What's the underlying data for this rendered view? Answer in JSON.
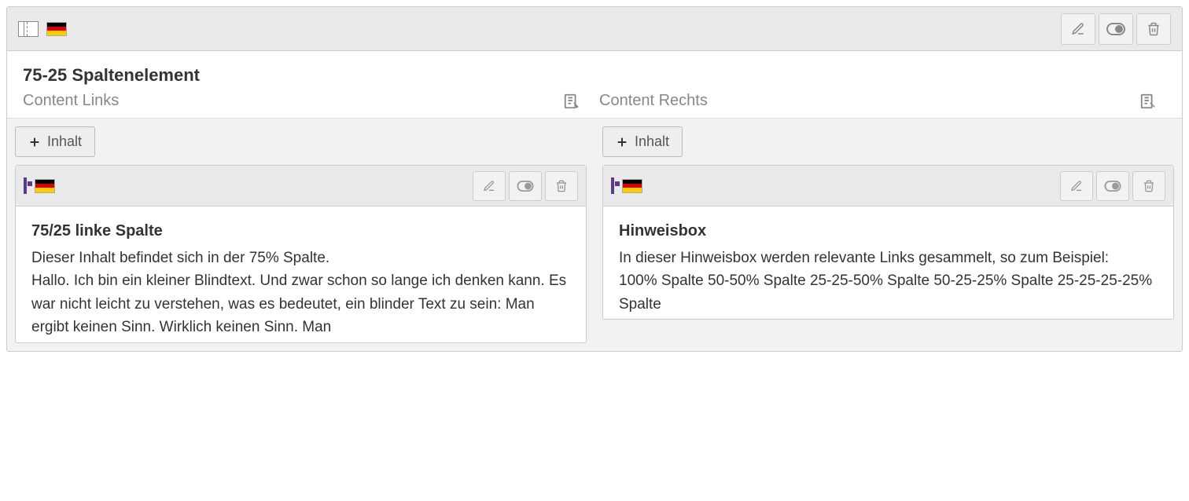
{
  "panel": {
    "locale": "de",
    "title": "75-25 Spaltenelement"
  },
  "columns": {
    "left": {
      "label": "Content Links",
      "add_button": "Inhalt",
      "card": {
        "title": "75/25 linke Spalte",
        "body_line1": "Dieser Inhalt befindet sich in der 75% Spalte.",
        "body_line2": "Hallo. Ich bin ein kleiner Blindtext. Und zwar schon so lange ich denken kann. Es war nicht leicht zu verstehen, was es bedeutet, ein blinder Text zu sein: Man ergibt keinen Sinn. Wirklich keinen Sinn. Man"
      }
    },
    "right": {
      "label": "Content Rechts",
      "add_button": "Inhalt",
      "card": {
        "title": "Hinweisbox",
        "body_line1": "In dieser Hinweisbox werden relevante Links gesammelt, so zum Beispiel:",
        "body_line2": "100% Spalte 50-50% Spalte 25-25-50% Spalte 50-25-25% Spalte 25-25-25-25% Spalte"
      }
    }
  }
}
